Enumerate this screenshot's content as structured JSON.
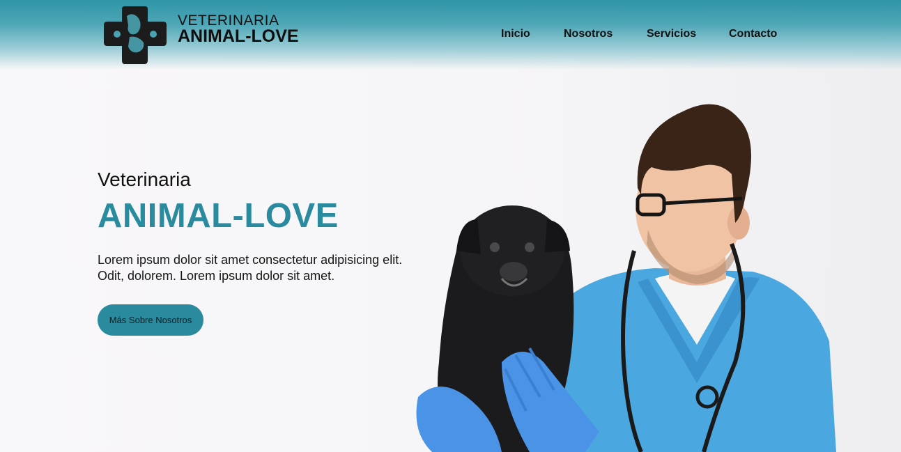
{
  "header": {
    "logo_line1": "VETERINARIA",
    "logo_line2": "ANIMAL-LOVE",
    "logo_icon": "pet-cross-icon",
    "gradient_top": "#2f95a8"
  },
  "nav": {
    "items": [
      {
        "label": "Inicio"
      },
      {
        "label": "Nosotros"
      },
      {
        "label": "Servicios"
      },
      {
        "label": "Contacto"
      }
    ]
  },
  "hero": {
    "subtitle": "Veterinaria",
    "title": "ANIMAL-LOVE",
    "text": "Lorem ipsum dolor sit amet consectetur adipisicing elit. Odit, dolorem. Lorem ipsum dolor sit amet.",
    "button_label": "Más Sobre Nosotros",
    "accent": "#2a8a9e",
    "image": "veterinarian-holding-black-pug"
  }
}
